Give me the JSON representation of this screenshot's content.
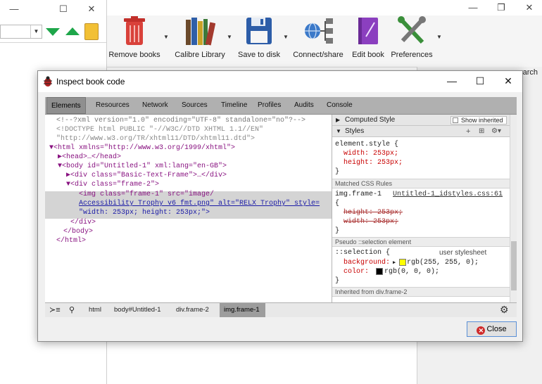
{
  "main_window": {
    "toolbar": [
      {
        "label": "Remove books",
        "icon": "trash-icon"
      },
      {
        "label": "Calibre Library",
        "icon": "library-icon"
      },
      {
        "label": "Save to disk",
        "icon": "floppy-disk-icon"
      },
      {
        "label": "Connect/share",
        "icon": "network-icon"
      },
      {
        "label": "Edit book",
        "icon": "book-icon"
      },
      {
        "label": "Preferences",
        "icon": "tools-icon"
      }
    ],
    "right_panel_text": "search"
  },
  "dialog": {
    "title": "Inspect book code",
    "tabs": [
      "Elements",
      "Resources",
      "Network",
      "Sources",
      "Timeline",
      "Profiles",
      "Audits",
      "Console"
    ],
    "active_tab": "Elements",
    "code_lines": [
      "<!--?xml version=\"1.0\" encoding=\"UTF-8\" standalone=\"no\"?-->",
      "<!DOCTYPE html PUBLIC \"-//W3C//DTD XHTML 1.1//EN\"",
      "\"http://www.w3.org/TR/xhtml11/DTD/xhtml11.dtd\">",
      "▼<html xmlns=\"http://www.w3.org/1999/xhtml\">",
      "▶<head>…</head>",
      "▼<body id=\"Untitled-1\" xml:lang=\"en-GB\">",
      "▶<div class=\"Basic-Text-Frame\">…</div>",
      "▼<div class=\"frame-2\">",
      "<img class=\"frame-1\" src=\"image/",
      "Accessibility Trophy v6 fmt.png\" alt=\"RELX Trophy\" style=",
      "\"width: 253px; height: 253px;\">",
      "</div>",
      "</body>",
      "</html>"
    ],
    "sidebar": {
      "computed_style": "Computed Style",
      "show_inherited": "Show inherited",
      "styles": "Styles",
      "element_style": [
        "element.style {",
        "width: 253px;",
        "height: 253px;",
        "}"
      ],
      "matched_rules": "Matched CSS Rules",
      "rule_selector": "img.frame-1",
      "rule_source": "Untitled-1_idstyles.css:61",
      "rule_lines": [
        "{",
        "height: 253px;",
        "width: 253px;",
        "}"
      ],
      "pseudo_header": "Pseudo ::selection element",
      "pseudo_selector": "::selection {",
      "pseudo_source": "user stylesheet",
      "pseudo_lines": [
        "background:",
        "rgb(255, 255, 0);",
        "color:",
        "rgb(0, 0, 0);",
        "}"
      ],
      "inherited": "Inherited from div.frame-2",
      "swatch_bg": "#ffff00",
      "swatch_color": "#000000"
    },
    "breadcrumbs": [
      "html",
      "body#Untitled-1",
      "div.frame-2",
      "img.frame-1"
    ],
    "close_label": "Close"
  }
}
